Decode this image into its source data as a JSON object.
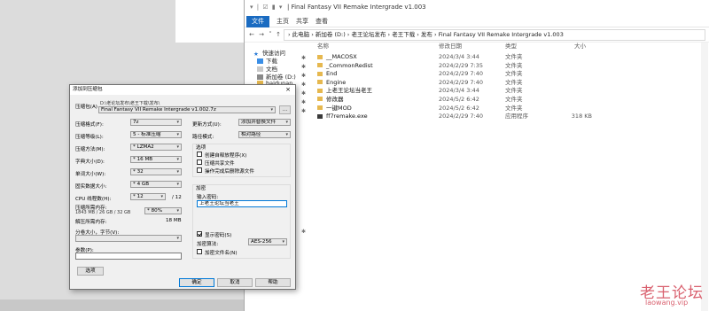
{
  "explorer": {
    "title": "| Final Fantasy VII Remake Intergrade v1.003",
    "quick_access": "▾ | ☑ ▮ ▾",
    "ribbon": {
      "file": "文件",
      "tabs": [
        "主页",
        "共享",
        "查看"
      ]
    },
    "address": "›  此电脑 › 新加卷 (D:) › 老王论坛发布 › 老王下载 › 发布 › Final Fantasy VII Remake Intergrade v1.003",
    "nav": [
      "快速访问",
      "下载",
      "文档",
      "新加卷 (D:)",
      "baidunan"
    ],
    "columns": {
      "name": "名称",
      "date": "修改日期",
      "type": "类型",
      "size": "大小"
    },
    "files": [
      {
        "name": "__MACOSX",
        "date": "2024/3/4 3:44",
        "type": "文件夹",
        "size": "",
        "icon": "folder-icon"
      },
      {
        "name": "_CommonRedist",
        "date": "2024/2/29 7:35",
        "type": "文件夹",
        "size": "",
        "icon": "folder-icon"
      },
      {
        "name": "End",
        "date": "2024/2/29 7:40",
        "type": "文件夹",
        "size": "",
        "icon": "folder-icon"
      },
      {
        "name": "Engine",
        "date": "2024/2/29 7:40",
        "type": "文件夹",
        "size": "",
        "icon": "folder-icon"
      },
      {
        "name": "上老王论坛当老王",
        "date": "2024/3/4 3:44",
        "type": "文件夹",
        "size": "",
        "icon": "folder-icon"
      },
      {
        "name": "修改器",
        "date": "2024/5/2 6:42",
        "type": "文件夹",
        "size": "",
        "icon": "folder-icon"
      },
      {
        "name": "一键MOD",
        "date": "2024/5/2 6:42",
        "type": "文件夹",
        "size": "",
        "icon": "folder-icon"
      },
      {
        "name": "ff7remake.exe",
        "date": "2024/2/29 7:40",
        "type": "应用程序",
        "size": "318 KB",
        "icon": "exe-icon"
      }
    ]
  },
  "dialog": {
    "title": "添加到压缩包",
    "close": "×",
    "archive_name_label": "压缩包(A)",
    "archive_path": "D:\\老论坛发布\\老王下载\\发布\\",
    "archive_name_value": "Final Fantasy VII Remake Intergrade v1.002.7z",
    "browse_button": "...",
    "format_label": "压缩格式(F):",
    "format_value": "7z",
    "level_label": "压缩等级(L):",
    "level_value": "5 - 标准压缩",
    "method_label": "压缩方法(M):",
    "method_value": "* LZMA2",
    "dict_label": "字典大小(D):",
    "dict_value": "* 16 MB",
    "word_label": "单词大小(W):",
    "word_value": "* 32",
    "solid_label": "固实数据大小:",
    "solid_value": "* 4 GB",
    "threads_label": "CPU 线程数(H):",
    "threads_value": "* 12",
    "threads_total": "/ 12",
    "memory_label": "压缩所需内存:",
    "memory_detail": "1843 MB / 26 GB / 32 GB",
    "memory_percent": "* 80%",
    "decomp_label": "解压所需内存:",
    "decomp_value": "18 MB",
    "split_label": "分卷大小，字节(V):",
    "split_value": "",
    "params_label": "参数(P):",
    "params_value": "",
    "options_button": "选项",
    "update_label": "更新方式(U):",
    "update_value": "添加并替换文件",
    "path_label": "路径模式:",
    "path_value": "相对路径",
    "options_group": "选项",
    "options": [
      {
        "label": "创建自释放程序(X)",
        "checked": false
      },
      {
        "label": "压缩共享文件",
        "checked": false
      },
      {
        "label": "操作完成后删除源文件",
        "checked": false
      }
    ],
    "encrypt_group": "加密",
    "password_label": "输入密码:",
    "password_value": "上老王论坛当老王",
    "show_password_label": "显示密码(S)",
    "show_password_checked": true,
    "enc_method_label": "加密算法:",
    "enc_method_value": "AES-256",
    "encrypt_names_label": "加密文件名(N)",
    "encrypt_names_checked": false,
    "ok_button": "确定",
    "cancel_button": "取消",
    "help_button": "帮助"
  },
  "watermark": {
    "title": "老王论坛",
    "url": "laowang.vip"
  },
  "colors": {
    "accent": "#1a6bc1",
    "watermark": "#d9616f",
    "folder": "#e6b84f"
  }
}
